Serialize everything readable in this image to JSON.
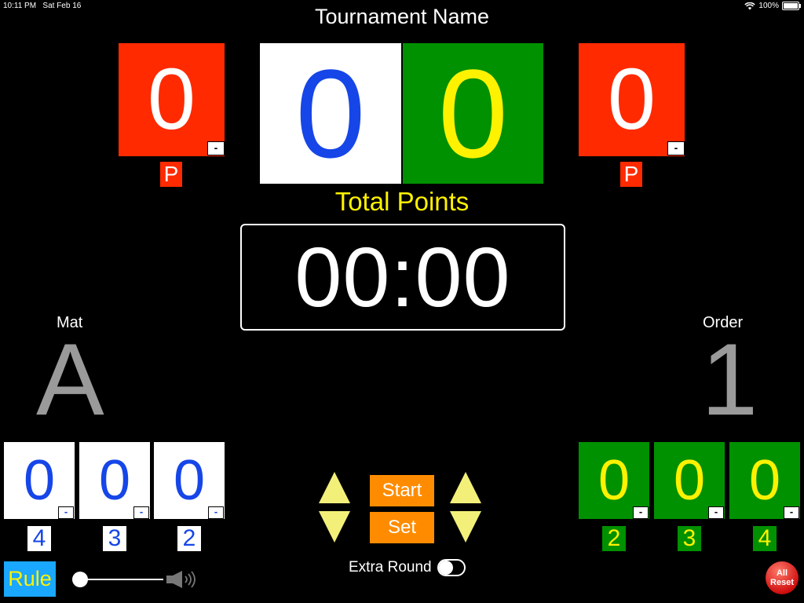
{
  "status": {
    "time": "10:11 PM",
    "date": "Sat Feb 16",
    "battery": "100%"
  },
  "title": "Tournament Name",
  "penalty": {
    "left": "0",
    "right": "0",
    "badge": "P",
    "minus": "-"
  },
  "score": {
    "white": "0",
    "green": "0"
  },
  "total_label": "Total Points",
  "timer": "00:00",
  "mat": {
    "label": "Mat",
    "value": "A"
  },
  "order": {
    "label": "Order",
    "value": "1"
  },
  "white_small": [
    {
      "value": "0",
      "label": "4"
    },
    {
      "value": "0",
      "label": "3"
    },
    {
      "value": "0",
      "label": "2"
    }
  ],
  "green_small": [
    {
      "value": "0",
      "label": "2"
    },
    {
      "value": "0",
      "label": "3"
    },
    {
      "value": "0",
      "label": "4"
    }
  ],
  "buttons": {
    "start": "Start",
    "set": "Set",
    "rule": "Rule",
    "reset_line1": "All",
    "reset_line2": "Reset"
  },
  "extra_round": {
    "label": "Extra Round",
    "on": false
  },
  "volume": {
    "level": 0
  },
  "colors": {
    "red": "#ff2a00",
    "green": "#009100",
    "blue": "#1646e8",
    "yellow": "#fff200",
    "orange": "#ff8c00",
    "rule_blue": "#1aa7ff"
  }
}
